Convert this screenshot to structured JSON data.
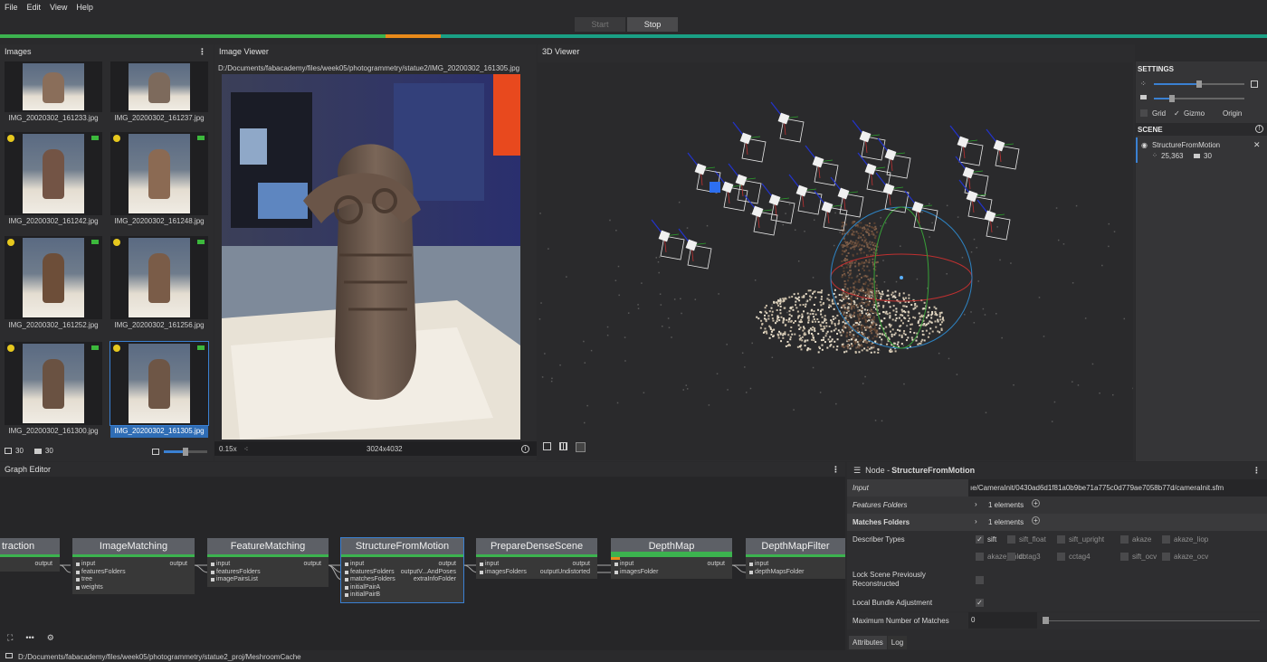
{
  "menu": [
    "File",
    "Edit",
    "View",
    "Help"
  ],
  "run": {
    "start_label": "Start",
    "stop_label": "Stop"
  },
  "colors": {
    "progress_done": "#3cb34f",
    "progress_running": "#e88a1a",
    "progress_rest": "#1aa085",
    "accent": "#3a80d2"
  },
  "images_panel": {
    "title": "Images",
    "thumbnails": [
      {
        "name": "IMG_20020302_161233.jpg",
        "badges": false,
        "selected": false
      },
      {
        "name": "IMG_20200302_161237.jpg",
        "badges": false,
        "selected": false
      },
      {
        "name": "IMG_20200302_161242.jpg",
        "badges": true,
        "selected": false
      },
      {
        "name": "IMG_20200302_161248.jpg",
        "badges": true,
        "selected": false
      },
      {
        "name": "IMG_20200302_161252.jpg",
        "badges": true,
        "selected": false
      },
      {
        "name": "IMG_20200302_161256.jpg",
        "badges": true,
        "selected": false
      },
      {
        "name": "IMG_20200302_161300.jpg",
        "badges": true,
        "selected": false
      },
      {
        "name": "IMG_20200302_161305.jpg",
        "badges": true,
        "selected": true
      }
    ],
    "image_count": "30",
    "camera_count": "30"
  },
  "image_viewer": {
    "title": "Image Viewer",
    "path": "D:/Documents/fabacademy/files/week05/photogrammetry/statue2/IMG_20200302_161305.jpg",
    "zoom": "0.15x",
    "resolution": "3024x4032"
  },
  "viewer3d": {
    "title": "3D Viewer"
  },
  "settings": {
    "title": "SETTINGS",
    "grid_label": "Grid",
    "gizmo_check": "✓",
    "gizmo_label": "Gizmo",
    "origin_label": "Origin",
    "scene_title": "SCENE",
    "scene_item": "StructureFromMotion",
    "points": "25,363",
    "cameras": "30"
  },
  "graph_editor": {
    "title": "Graph Editor",
    "nodes": [
      {
        "name": "traction",
        "inputs": [],
        "outputs": [
          "output"
        ]
      },
      {
        "name": "ImageMatching",
        "inputs": [
          "input",
          "featuresFolders",
          "tree",
          "weights"
        ],
        "outputs": [
          "output"
        ]
      },
      {
        "name": "FeatureMatching",
        "inputs": [
          "input",
          "featuresFolders",
          "imagePairsList"
        ],
        "outputs": [
          "output"
        ]
      },
      {
        "name": "StructureFromMotion",
        "inputs": [
          "input",
          "featuresFolders",
          "matchesFolders",
          "initialPairA",
          "initialPairB"
        ],
        "outputs": [
          "output",
          "outputV...AndPoses",
          "extraInfoFolder"
        ]
      },
      {
        "name": "PrepareDenseScene",
        "inputs": [
          "input",
          "imagesFolders"
        ],
        "outputs": [
          "output",
          "outputUndistorted"
        ]
      },
      {
        "name": "DepthMap",
        "inputs": [
          "input",
          "imagesFolder"
        ],
        "outputs": [
          "output"
        ]
      },
      {
        "name": "DepthMapFilter",
        "inputs": [
          "input",
          "depthMapsFolder"
        ],
        "outputs": []
      }
    ]
  },
  "attributes": {
    "node_prefix": "Node - ",
    "node_name": "StructureFromMotion",
    "input_label": "Input",
    "input_value": "ıe/CameraInit/0430ad6d1f81a0b9be71a775c0d779ae7058b77d/cameraInit.sfm",
    "features_label": "Features Folders",
    "features_value": "1 elements",
    "matches_label": "Matches Folders",
    "matches_value": "1 elements",
    "describer_label": "Describer Types",
    "describers_row1": [
      {
        "name": "sift",
        "checked": true
      },
      {
        "name": "sift_float",
        "checked": false
      },
      {
        "name": "sift_upright",
        "checked": false
      },
      {
        "name": "akaze",
        "checked": false
      },
      {
        "name": "akaze_liop",
        "checked": false
      }
    ],
    "describers_row2": [
      {
        "name": "akaze_mldb",
        "checked": false
      },
      {
        "name": "cctag3",
        "checked": false
      },
      {
        "name": "cctag4",
        "checked": false
      },
      {
        "name": "sift_ocv",
        "checked": false
      },
      {
        "name": "akaze_ocv",
        "checked": false
      }
    ],
    "lock_label_1": "Lock Scene Previously",
    "lock_label_2": "Reconstructed",
    "bundle_label": "Local Bundle Adjustment",
    "bundle_check": "✓",
    "maxmatch_label": "Maximum Number of Matches",
    "maxmatch_value": "0",
    "tabs": [
      "Attributes",
      "Log"
    ]
  },
  "status": {
    "cache_path": "D:/Documents/fabacademy/files/week05/photogrammetry/statue2_proj/MeshroomCache"
  }
}
